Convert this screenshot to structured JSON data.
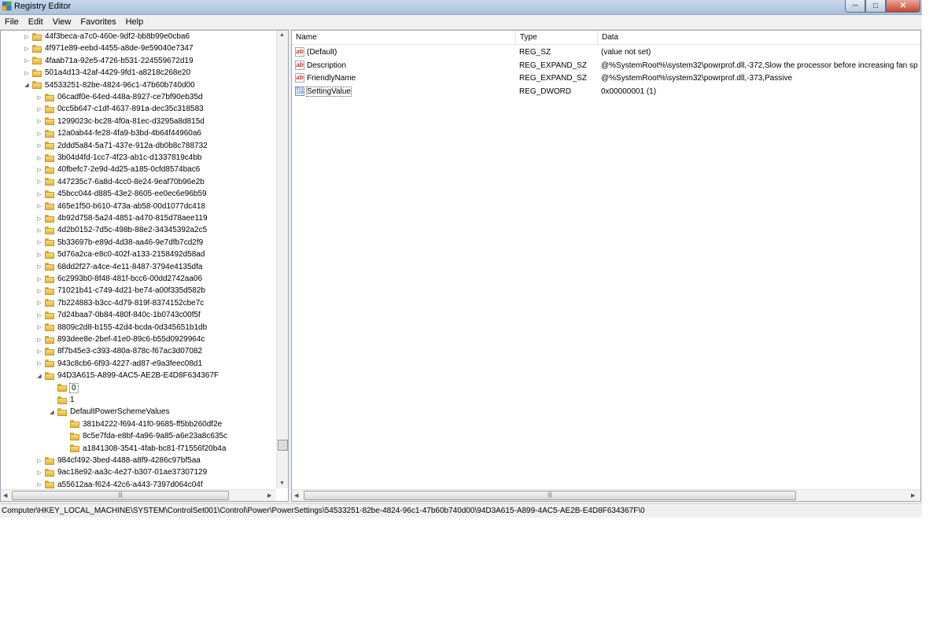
{
  "window": {
    "title": "Registry Editor"
  },
  "menu": [
    "File",
    "Edit",
    "View",
    "Favorites",
    "Help"
  ],
  "tree": [
    {
      "label": "44f3beca-a7c0-460e-9df2-bb8b99e0cba6",
      "level": 3,
      "exp": "collapsed"
    },
    {
      "label": "4f971e89-eebd-4455-a8de-9e59040e7347",
      "level": 3,
      "exp": "collapsed"
    },
    {
      "label": "4faab71a-92e5-4726-b531-224559672d19",
      "level": 3,
      "exp": "collapsed"
    },
    {
      "label": "501a4d13-42af-4429-9fd1-a8218c268e20",
      "level": 3,
      "exp": "collapsed"
    },
    {
      "label": "54533251-82be-4824-96c1-47b60b740d00",
      "level": 3,
      "exp": "expanded"
    },
    {
      "label": "06cadf0e-64ed-448a-8927-ce7bf90eb35d",
      "level": 4,
      "exp": "collapsed"
    },
    {
      "label": "0cc5b647-c1df-4637-891a-dec35c318583",
      "level": 4,
      "exp": "collapsed"
    },
    {
      "label": "1299023c-bc28-4f0a-81ec-d3295a8d815d",
      "level": 4,
      "exp": "collapsed"
    },
    {
      "label": "12a0ab44-fe28-4fa9-b3bd-4b64f44960a6",
      "level": 4,
      "exp": "collapsed"
    },
    {
      "label": "2ddd5a84-5a71-437e-912a-db0b8c788732",
      "level": 4,
      "exp": "collapsed"
    },
    {
      "label": "3b04d4fd-1cc7-4f23-ab1c-d1337819c4bb",
      "level": 4,
      "exp": "collapsed"
    },
    {
      "label": "40fbefc7-2e9d-4d25-a185-0cfd8574bac6",
      "level": 4,
      "exp": "collapsed"
    },
    {
      "label": "447235c7-6a8d-4cc0-8e24-9eaf70b96e2b",
      "level": 4,
      "exp": "collapsed"
    },
    {
      "label": "45bcc044-d885-43e2-8605-ee0ec6e96b59",
      "level": 4,
      "exp": "collapsed"
    },
    {
      "label": "465e1f50-b610-473a-ab58-00d1077dc418",
      "level": 4,
      "exp": "collapsed"
    },
    {
      "label": "4b92d758-5a24-4851-a470-815d78aee119",
      "level": 4,
      "exp": "collapsed"
    },
    {
      "label": "4d2b0152-7d5c-498b-88e2-34345392a2c5",
      "level": 4,
      "exp": "collapsed"
    },
    {
      "label": "5b33697b-e89d-4d38-aa46-9e7dfb7cd2f9",
      "level": 4,
      "exp": "collapsed"
    },
    {
      "label": "5d76a2ca-e8c0-402f-a133-2158492d58ad",
      "level": 4,
      "exp": "collapsed"
    },
    {
      "label": "68dd2f27-a4ce-4e11-8487-3794e4135dfa",
      "level": 4,
      "exp": "collapsed"
    },
    {
      "label": "6c2993b0-8f48-481f-bcc6-00dd2742aa06",
      "level": 4,
      "exp": "collapsed"
    },
    {
      "label": "71021b41-c749-4d21-be74-a00f335d582b",
      "level": 4,
      "exp": "collapsed"
    },
    {
      "label": "7b224883-b3cc-4d79-819f-8374152cbe7c",
      "level": 4,
      "exp": "collapsed"
    },
    {
      "label": "7d24baa7-0b84-480f-840c-1b0743c00f5f",
      "level": 4,
      "exp": "collapsed"
    },
    {
      "label": "8809c2d8-b155-42d4-bcda-0d345651b1db",
      "level": 4,
      "exp": "collapsed"
    },
    {
      "label": "893dee8e-2bef-41e0-89c6-b55d0929964c",
      "level": 4,
      "exp": "collapsed"
    },
    {
      "label": "8f7b45e3-c393-480a-878c-f67ac3d07082",
      "level": 4,
      "exp": "collapsed"
    },
    {
      "label": "943c8cb6-6f93-4227-ad87-e9a3feec08d1",
      "level": 4,
      "exp": "collapsed"
    },
    {
      "label": "94D3A615-A899-4AC5-AE2B-E4D8F634367F",
      "level": 4,
      "exp": "expanded"
    },
    {
      "label": "0",
      "level": 5,
      "exp": "none",
      "selected": true
    },
    {
      "label": "1",
      "level": 5,
      "exp": "none"
    },
    {
      "label": "DefaultPowerSchemeValues",
      "level": 5,
      "exp": "expanded"
    },
    {
      "label": "381b4222-f694-41f0-9685-ff5bb260df2e",
      "level": 6,
      "exp": "none"
    },
    {
      "label": "8c5e7fda-e8bf-4a96-9a85-a6e23a8c635c",
      "level": 6,
      "exp": "none"
    },
    {
      "label": "a1841308-3541-4fab-bc81-f71556f20b4a",
      "level": 6,
      "exp": "none"
    },
    {
      "label": "984cf492-3bed-4488-a8f9-4286c97bf5aa",
      "level": 4,
      "exp": "collapsed"
    },
    {
      "label": "9ac18e92-aa3c-4e27-b307-01ae37307129",
      "level": 4,
      "exp": "collapsed"
    },
    {
      "label": "a55612aa-f624-42c6-a443-7397d064c04f",
      "level": 4,
      "exp": "collapsed"
    }
  ],
  "columns": {
    "name": "Name",
    "type": "Type",
    "data": "Data"
  },
  "values": [
    {
      "icon": "string-value-icon",
      "name": "(Default)",
      "type": "REG_SZ",
      "data": "(value not set)"
    },
    {
      "icon": "string-value-icon",
      "name": "Description",
      "type": "REG_EXPAND_SZ",
      "data": "@%SystemRoot%\\system32\\powrprof.dll,-372,Slow the processor before increasing fan sp"
    },
    {
      "icon": "string-value-icon",
      "name": "FriendlyName",
      "type": "REG_EXPAND_SZ",
      "data": "@%SystemRoot%\\system32\\powrprof.dll,-373,Passive"
    },
    {
      "icon": "binary-value-icon",
      "name": "SettingValue",
      "type": "REG_DWORD",
      "data": "0x00000001 (1)",
      "focused": true
    }
  ],
  "icons": {
    "string": "ab",
    "binary": "011\n110"
  },
  "statusbar": {
    "path": "Computer\\HKEY_LOCAL_MACHINE\\SYSTEM\\ControlSet001\\Control\\Power\\PowerSettings\\54533251-82be-4824-96c1-47b60b740d00\\94D3A615-A899-4AC5-AE2B-E4D8F634367F\\0"
  }
}
